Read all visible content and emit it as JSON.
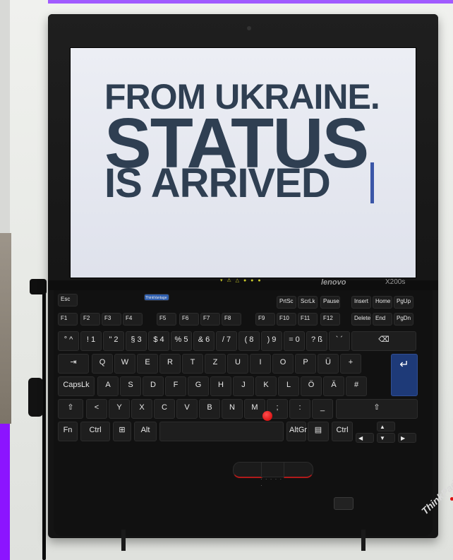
{
  "screen": {
    "line1": "FROM UKRAINE.",
    "line2": "STATUS",
    "line3": "IS ARRIVED"
  },
  "laptop": {
    "brand": "lenovo",
    "model": "X200s",
    "badge": "ThinkPad"
  },
  "keyboard": {
    "top_row": [
      "Esc",
      "ThinkVantage"
    ],
    "fn_row": [
      "F1",
      "F2",
      "F3",
      "F4",
      "F5",
      "F6",
      "F7",
      "F8",
      "F9",
      "F10",
      "F11",
      "F12",
      "Delete",
      "End",
      "PgDn"
    ],
    "fn_row_top": [
      "PrtSc",
      "ScrLk",
      "Pause",
      "Insert",
      "Home",
      "PgUp"
    ],
    "num_row": [
      "°\n^",
      "!\n1",
      "\"\n2",
      "§\n3",
      "$\n4",
      "%\n5",
      "&\n6",
      "/\n7",
      "(\n8",
      ")\n9",
      "=\n0",
      "?\nß",
      "`\n´"
    ],
    "backspace": "⌫",
    "tab": "⇥",
    "row_q": [
      "Q",
      "W",
      "E",
      "R",
      "T",
      "Z",
      "U",
      "I",
      "O",
      "P",
      "Ü",
      "+"
    ],
    "enter": "↵",
    "capslock": "CapsLk",
    "row_a": [
      "A",
      "S",
      "D",
      "F",
      "G",
      "H",
      "J",
      "K",
      "L",
      "Ö",
      "Ä",
      "#"
    ],
    "shift_left": "⇧",
    "row_z": [
      "<",
      "Y",
      "X",
      "C",
      "V",
      "B",
      "N",
      "M",
      ";",
      ":",
      "_"
    ],
    "shift_right": "⇧",
    "bottom_row": [
      "Fn",
      "Ctrl",
      "⊞",
      "Alt",
      "",
      "AltGr",
      "▤",
      "Ctrl"
    ],
    "arrows": [
      "▲",
      "◀",
      "▼",
      "▶"
    ]
  },
  "colors": {
    "headline": "#2f3f52",
    "cursor": "#3b56a8",
    "trackpoint": "#e01010",
    "enter_key": "#1e3a78",
    "frame_purple": "#8c14ff"
  }
}
